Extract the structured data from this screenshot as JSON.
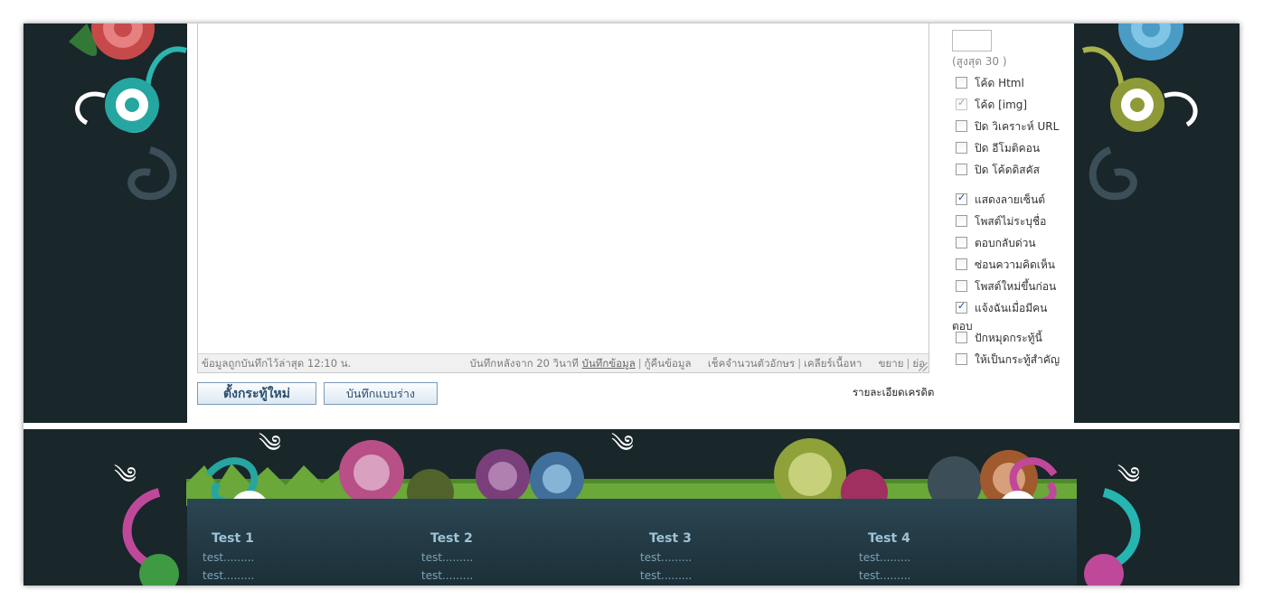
{
  "editor": {
    "status_saved": "ข้อมูลถูกบันทึกไว้ล่าสุด 12:10 น.",
    "autosave_prefix": "บันทึกหลังจาก 20 วินาที",
    "save_link": "บันทึกข้อมูล",
    "restore_link": "กู้คืนข้อมูล",
    "count_link": "เช็คจำนวนตัวอักษร",
    "clear_link": "เคลียร์เนื้อหา",
    "expand_link": "ขยาย",
    "shrink_link": "ย่อ"
  },
  "buttons": {
    "new_topic": "ตั้งกระทู้ใหม่",
    "save_draft": "บันทึกแบบร่าง"
  },
  "credit_link": "รายละเอียดเครดิต",
  "options": {
    "max_label": "(สูงสุด 30 )",
    "max_value": "",
    "items": [
      {
        "label": "โค้ด Html",
        "checked": false
      },
      {
        "label": "โค้ด [img]",
        "checked": true
      },
      {
        "label": "ปิด วิเคราะห์ URL",
        "checked": false
      },
      {
        "label": "ปิด อีโมติคอน",
        "checked": false
      },
      {
        "label": "ปิด โค้ดดิสคัส",
        "checked": false
      },
      {
        "label": "แสดงลายเซ็นต์",
        "checked": true
      },
      {
        "label": "โพสต์ไม่ระบุชื่อ",
        "checked": false
      },
      {
        "label": "ตอบกลับด่วน",
        "checked": false
      },
      {
        "label": "ซ่อนความคิดเห็น",
        "checked": false
      },
      {
        "label": "โพสต์ใหม่ขึ้นก่อน",
        "checked": false
      },
      {
        "label": "แจ้งฉันเมื่อมีคน",
        "checked": true
      },
      {
        "label": "ปักหมุดกระทู้นี้",
        "checked": false
      },
      {
        "label": "ให้เป็นกระทู้สำคัญ",
        "checked": false
      }
    ],
    "orphan_text": "ตอบ"
  },
  "footer": {
    "columns": [
      {
        "title": "Test 1",
        "items": [
          "test.........",
          "test........."
        ]
      },
      {
        "title": "Test 2",
        "items": [
          "test.........",
          "test........."
        ]
      },
      {
        "title": "Test 3",
        "items": [
          "test.........",
          "test........."
        ]
      },
      {
        "title": "Test 4",
        "items": [
          "test.........",
          "test........."
        ]
      }
    ]
  },
  "colors": {
    "background": "#19262a",
    "footer_header": "#9ec3d6",
    "footer_item": "#7ba4b8",
    "button_text": "#2b4f6f"
  }
}
